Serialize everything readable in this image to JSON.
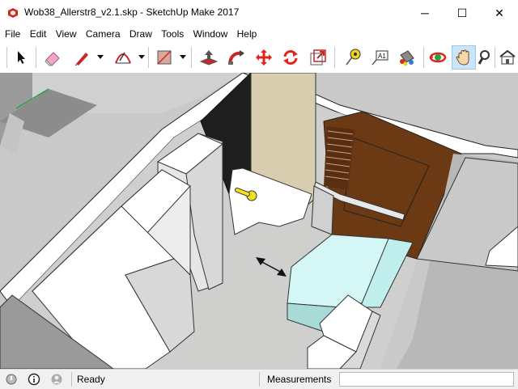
{
  "window": {
    "title": "Wob38_Allerstr8_v2.1.skp - SketchUp Make 2017",
    "controls": {
      "minimize": "─",
      "maximize": "☐",
      "close": "✕"
    }
  },
  "menu": [
    "File",
    "Edit",
    "View",
    "Camera",
    "Draw",
    "Tools",
    "Window",
    "Help"
  ],
  "toolbar": {
    "tools": [
      {
        "name": "select-tool-icon"
      },
      {
        "name": "eraser-tool-icon"
      },
      {
        "name": "line-tool-icon"
      },
      {
        "name": "arc-tool-icon"
      },
      {
        "name": "rectangle-tool-icon"
      },
      {
        "name": "push-pull-tool-icon"
      },
      {
        "name": "follow-me-tool-icon"
      },
      {
        "name": "move-tool-icon"
      },
      {
        "name": "rotate-tool-icon"
      },
      {
        "name": "scale-tool-icon"
      },
      {
        "name": "tape-measure-tool-icon"
      },
      {
        "name": "text-tool-icon",
        "label": "A1"
      },
      {
        "name": "paint-bucket-tool-icon"
      },
      {
        "name": "orbit-tool-icon"
      },
      {
        "name": "pan-tool-icon",
        "active": true
      },
      {
        "name": "zoom-tool-icon"
      },
      {
        "name": "warehouse-icon"
      }
    ]
  },
  "colors": {
    "floor": "#cfcfcd",
    "wall_top": "#ffffff",
    "dark_panel": "#1e1e1e",
    "beige_wall": "#d8ceaf",
    "wardrobe": "#6b3a15",
    "bed": "#d4f7f5",
    "desk_knob": "#f2e01a",
    "accent_red": "#e1251b"
  },
  "status": {
    "text": "Ready",
    "measurements_label": "Measurements",
    "measurements_value": ""
  }
}
